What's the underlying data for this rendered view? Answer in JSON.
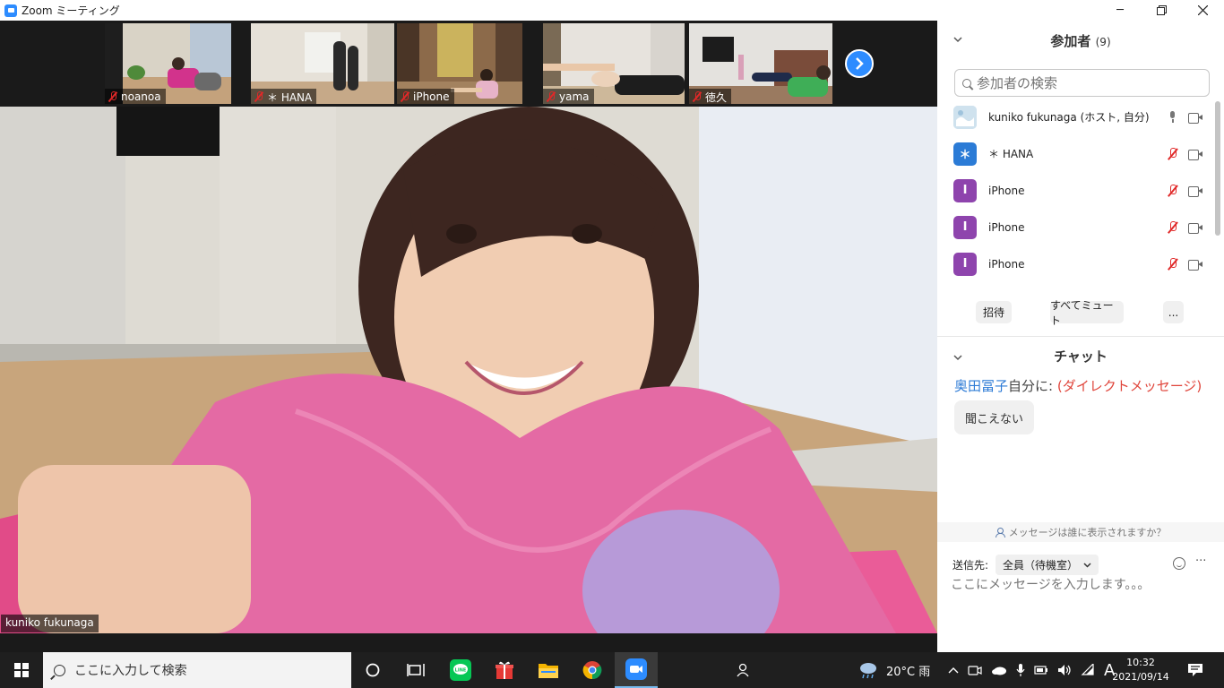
{
  "window": {
    "title": "Zoom ミーティング",
    "accent": "#2d8cff"
  },
  "thumbnails": [
    {
      "name": "noanoa"
    },
    {
      "name": "＊ HANA"
    },
    {
      "name": "iPhone"
    },
    {
      "name": "yama"
    },
    {
      "name": "徳久"
    }
  ],
  "main_video": {
    "name": "kuniko fukunaga"
  },
  "participants_panel": {
    "title": "参加者",
    "count": "(9)",
    "search_placeholder": "参加者の検索",
    "participants": [
      {
        "name": "kuniko fukunaga (ホスト, 自分)",
        "avatar": "",
        "muted": false
      },
      {
        "name": "＊ HANA",
        "avatar": "＊",
        "avatar_color": "#2b7bd6",
        "muted": true
      },
      {
        "name": "iPhone",
        "avatar": "I",
        "avatar_color": "#8e44ad",
        "muted": true
      },
      {
        "name": "iPhone",
        "avatar": "I",
        "avatar_color": "#8e44ad",
        "muted": true
      },
      {
        "name": "iPhone",
        "avatar": "I",
        "avatar_color": "#8e44ad",
        "muted": true
      }
    ],
    "buttons": {
      "invite": "招待",
      "mute_all": "すべてミュート",
      "more": "..."
    }
  },
  "chat": {
    "title": "チャット",
    "message": {
      "sender": "奥田冨子",
      "to": "自分に: ",
      "dm_tag": "(ダイレクトメッセージ)",
      "text": "聞こえない"
    },
    "visibility_text": "メッセージは誰に表示されますか？",
    "send_to_label": "送信先:",
    "send_to_value": "全員（待機室）",
    "input_placeholder": "ここにメッセージを入力します。。。"
  },
  "taskbar": {
    "search_placeholder": "ここに入力して検索",
    "weather": "20°C 雨",
    "ime": "A",
    "time": "10:32",
    "date": "2021/09/14"
  }
}
